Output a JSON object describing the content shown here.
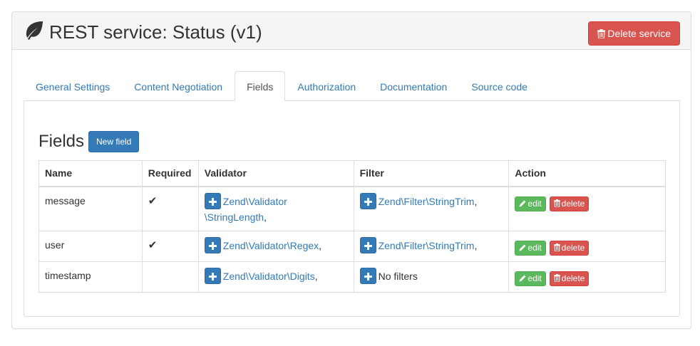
{
  "header": {
    "title": "REST service: Status (v1)",
    "delete_service_label": "Delete service"
  },
  "tabs": [
    {
      "label": "General Settings",
      "active": false
    },
    {
      "label": "Content Negotiation",
      "active": false
    },
    {
      "label": "Fields",
      "active": true
    },
    {
      "label": "Authorization",
      "active": false
    },
    {
      "label": "Documentation",
      "active": false
    },
    {
      "label": "Source code",
      "active": false
    }
  ],
  "fields_section": {
    "title": "Fields",
    "new_field_label": "New field",
    "columns": [
      "Name",
      "Required",
      "Validator",
      "Filter",
      "Action"
    ],
    "rows": [
      {
        "name": "message",
        "required": "✔",
        "validator_line1": "Zend\\Validator",
        "validator_line2": "\\StringLength",
        "validator_sep": ",",
        "filter": "Zend\\Filter\\StringTrim",
        "filter_sep": ","
      },
      {
        "name": "user",
        "required": "✔",
        "validator_line1": "Zend\\Validator\\Regex",
        "validator_sep": ",",
        "filter": "Zend\\Filter\\StringTrim",
        "filter_sep": ","
      },
      {
        "name": "timestamp",
        "required": "",
        "validator_line1": "Zend\\Validator\\Digits",
        "validator_sep": ",",
        "filter_none": "No filters"
      }
    ],
    "edit_label": "edit",
    "delete_label": "delete"
  },
  "colors": {
    "primary": "#337ab7",
    "danger": "#d9534f",
    "success": "#5cb85c",
    "panel_heading_bg": "#f5f5f5",
    "border": "#dddddd"
  },
  "icons": {
    "title": "leaf-icon",
    "delete": "trash-icon",
    "edit": "pencil-icon",
    "add": "plus-icon",
    "required": "check-icon"
  }
}
